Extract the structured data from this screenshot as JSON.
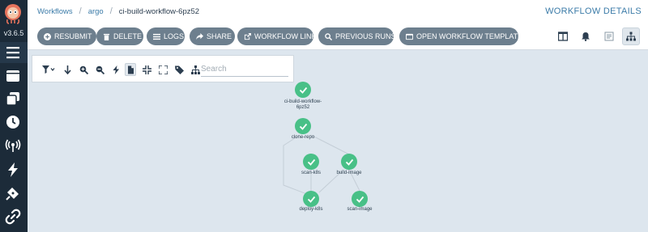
{
  "app": {
    "version": "v3.6.5"
  },
  "header": {
    "breadcrumb": [
      "Workflows",
      "argo",
      "ci-build-workflow-6pz52"
    ],
    "title": "WORKFLOW DETAILS"
  },
  "toolbar": {
    "buttons": [
      {
        "label": "RESUBMIT",
        "icon": "plus-circle-icon"
      },
      {
        "label": "DELETE",
        "icon": "trash-icon"
      },
      {
        "label": "LOGS",
        "icon": "bars-icon"
      },
      {
        "label": "SHARE",
        "icon": "share-icon"
      },
      {
        "label": "WORKFLOW LINK",
        "icon": "external-link-icon"
      },
      {
        "label": "PREVIOUS RUNS",
        "icon": "search-icon"
      },
      {
        "label": "OPEN WORKFLOW TEMPLATE",
        "icon": "window-icon"
      }
    ],
    "button_color": "#6d7f8e"
  },
  "graph": {
    "search_placeholder": "Search",
    "node_color": "#48c087",
    "nodes": [
      {
        "id": "ci-build-workflow-6pz52",
        "label": "ci-build-workflow-6pz52",
        "status": "succeeded"
      },
      {
        "id": "clone-repo",
        "label": "clone-repo",
        "status": "succeeded"
      },
      {
        "id": "scan-k8s",
        "label": "scan-k8s",
        "status": "succeeded"
      },
      {
        "id": "build-image",
        "label": "build-image",
        "status": "succeeded"
      },
      {
        "id": "deploy-k8s",
        "label": "deploy-k8s",
        "status": "succeeded"
      },
      {
        "id": "scan-image",
        "label": "scan-image",
        "status": "succeeded"
      }
    ],
    "edges": [
      [
        "clone-repo",
        "scan-k8s"
      ],
      [
        "clone-repo",
        "build-image"
      ],
      [
        "scan-k8s",
        "deploy-k8s"
      ],
      [
        "build-image",
        "deploy-k8s"
      ],
      [
        "build-image",
        "scan-image"
      ]
    ]
  }
}
